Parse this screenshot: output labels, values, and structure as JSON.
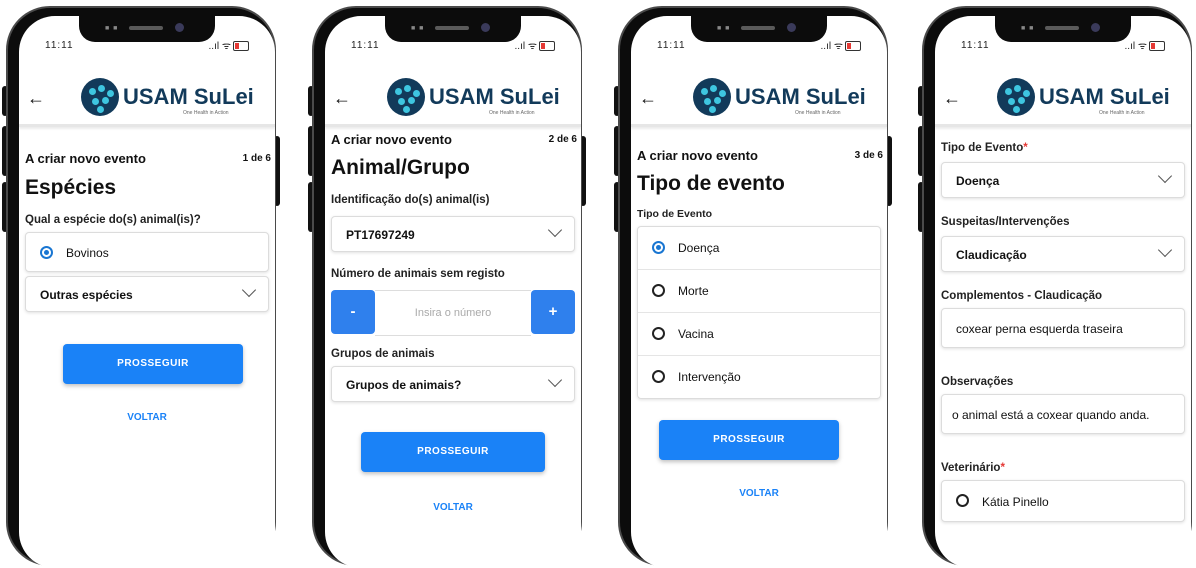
{
  "status": {
    "time": "11:11",
    "signal": "..ıl ᯤ"
  },
  "header": {
    "brand": "USAM SuLei",
    "tagline": "One Health in Action"
  },
  "colors": {
    "accent": "#1a82f7",
    "required": "#e53935",
    "brand": "#123a5a"
  },
  "phone1": {
    "subtitle": "A criar novo evento",
    "step": "1 de 6",
    "title": "Espécies",
    "question": "Qual a espécie do(s) animal(is)?",
    "option_selected": "Bovinos",
    "dropdown": "Outras espécies",
    "continue": "PROSSEGUIR",
    "back": "VOLTAR"
  },
  "phone2": {
    "subtitle": "A criar novo evento",
    "step": "2 de 6",
    "title": "Animal/Grupo",
    "id_label": "Identificação do(s) animal(is)",
    "id_value": "PT17697249",
    "count_label": "Número de animais sem registo",
    "count_placeholder": "Insira o número",
    "minus": "-",
    "plus": "+",
    "groups_label": "Grupos de animais",
    "groups_value": "Grupos de animais?",
    "continue": "PROSSEGUIR",
    "back": "VOLTAR"
  },
  "phone3": {
    "subtitle": "A criar novo evento",
    "step": "3 de 6",
    "title": "Tipo de evento",
    "label": "Tipo de Evento",
    "options": [
      "Doença",
      "Morte",
      "Vacina",
      "Intervenção"
    ],
    "selected_index": 0,
    "continue": "PROSSEGUIR",
    "back": "VOLTAR"
  },
  "phone4": {
    "type_label": "Tipo de Evento",
    "required_mark": "*",
    "type_value": "Doença",
    "suspect_label": "Suspeitas/Intervenções",
    "suspect_value": "Claudicação",
    "compl_label": "Complementos - Claudicação",
    "compl_value": "coxear perna esquerda traseira",
    "obs_label": "Observações",
    "obs_value": "o animal está a coxear quando anda.",
    "vet_label": "Veterinário",
    "vet_option": "Kátia Pinello"
  }
}
